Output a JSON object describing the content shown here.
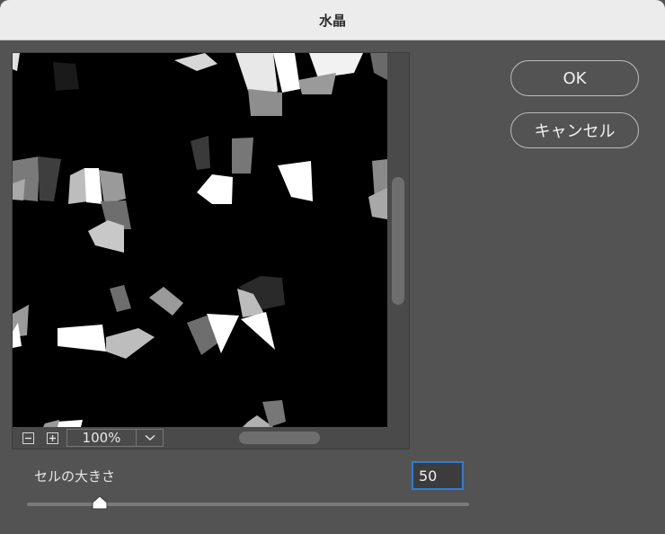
{
  "window": {
    "title": "水晶"
  },
  "preview": {
    "zoom_label": "100%"
  },
  "buttons": {
    "ok": "OK",
    "cancel": "キャンセル"
  },
  "controls": {
    "cell_size_label": "セルの大きさ",
    "cell_size_value": "50"
  },
  "icons": {
    "zoom_out": "minus-icon",
    "zoom_in": "plus-icon",
    "dropdown": "chevron-down-icon",
    "slider_thumb": "triangle-thumb-icon"
  }
}
